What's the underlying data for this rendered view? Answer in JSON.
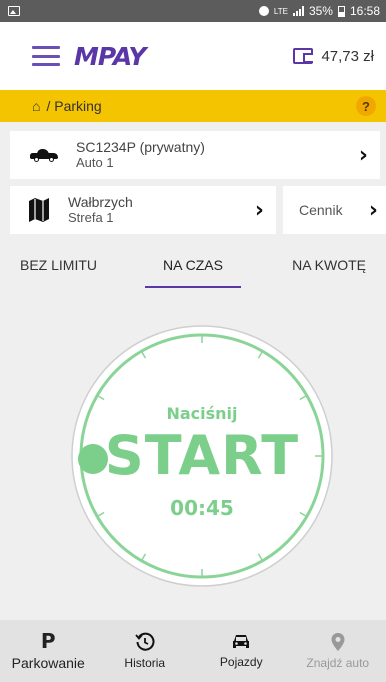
{
  "status_bar": {
    "network": "LTE",
    "battery": "35%",
    "time": "16:58"
  },
  "header": {
    "logo": "MPAY",
    "balance": "47,73 zł"
  },
  "breadcrumb": {
    "path": "/ Parking",
    "help": "?"
  },
  "vehicle": {
    "plate": "SC1234P (prywatny)",
    "name": "Auto 1"
  },
  "zone": {
    "city": "Wałbrzych",
    "zone": "Strefa 1"
  },
  "price_list": {
    "label": "Cennik"
  },
  "tabs": [
    {
      "label": "BEZ LIMITU",
      "active": false
    },
    {
      "label": "NA CZAS",
      "active": true
    },
    {
      "label": "NA KWOTĘ",
      "active": false
    }
  ],
  "timer": {
    "hint": "Naciśnij",
    "action": "START",
    "time": "00:45",
    "accent": "#7ccf8b"
  },
  "bottom_nav": [
    {
      "label": "Parkowanie",
      "icon": "parking-icon",
      "active": true
    },
    {
      "label": "Historia",
      "icon": "history-icon",
      "active": false
    },
    {
      "label": "Pojazdy",
      "icon": "car-icon",
      "active": false
    },
    {
      "label": "Znajdź auto",
      "icon": "location-pin-icon",
      "active": false
    }
  ],
  "colors": {
    "brand": "#5a36a6",
    "breadcrumb_bg": "#f5c400",
    "timer_green": "#7ccf8b"
  }
}
